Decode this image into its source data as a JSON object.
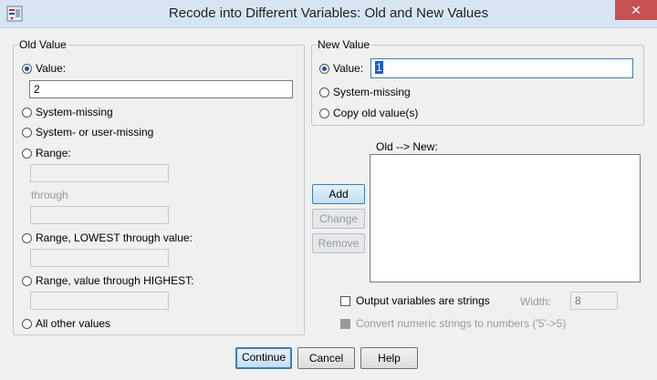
{
  "window": {
    "title": "Recode into Different Variables: Old and New Values",
    "close_glyph": "✕"
  },
  "old_value": {
    "legend": "Old Value",
    "value_label": "Value:",
    "value_input": "2",
    "system_missing": "System-missing",
    "system_or_user_missing": "System- or user-missing",
    "range_label": "Range:",
    "through_label": "through",
    "range_lowest": "Range, LOWEST through value:",
    "range_highest": "Range, value through HIGHEST:",
    "all_other": "All other values"
  },
  "new_value": {
    "legend": "New Value",
    "value_label": "Value:",
    "value_input": "1",
    "system_missing": "System-missing",
    "copy_old": "Copy old value(s)"
  },
  "mapping": {
    "label": "Old --> New:",
    "add": "Add",
    "change": "Change",
    "remove": "Remove"
  },
  "options": {
    "output_strings": "Output variables are strings",
    "width_label": "Width:",
    "width_value": "8",
    "convert_numeric": "Convert numeric strings to numbers ('5'->5)"
  },
  "buttons": {
    "continue": "Continue",
    "cancel": "Cancel",
    "help": "Help"
  },
  "selected": {
    "old": "value",
    "new": "value"
  },
  "colors": {
    "accent": "#3c7fb1",
    "close": "#c75050",
    "selection": "#1d5bd0"
  }
}
